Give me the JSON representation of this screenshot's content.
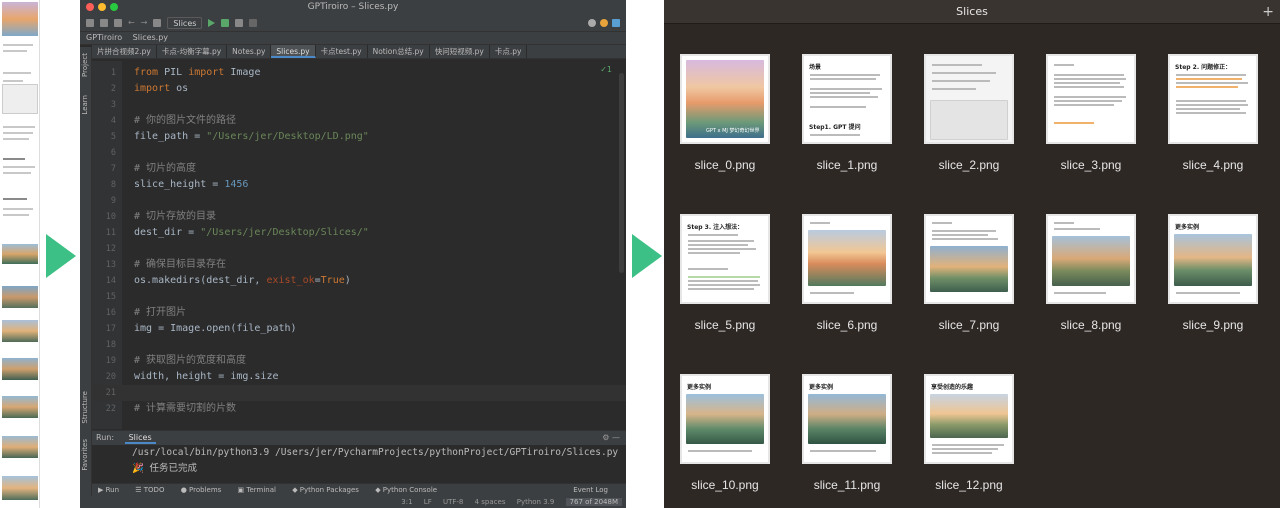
{
  "ide": {
    "window_title": "GPTiroiro – Slices.py",
    "run_config": "Slices",
    "breadcrumbs": [
      "GPTiroiro",
      "Slices.py"
    ],
    "tabs": [
      "片拼合视频2.py",
      "卡点-均衡字幕.py",
      "Notes.py",
      "Slices.py",
      "卡点test.py",
      "Notion总结.py",
      "快问短视频.py",
      "卡点.py"
    ],
    "active_tab": "Slices.py",
    "side_labels": [
      "Project",
      "Learn",
      "Structure",
      "Favorites"
    ],
    "inspection": "✓1",
    "code": [
      {
        "n": "1",
        "parts": [
          {
            "t": "from ",
            "c": "kw"
          },
          {
            "t": "PIL ",
            "c": "id"
          },
          {
            "t": "import ",
            "c": "kw"
          },
          {
            "t": "Image",
            "c": "id"
          }
        ]
      },
      {
        "n": "2",
        "parts": [
          {
            "t": "import ",
            "c": "kw"
          },
          {
            "t": "os",
            "c": "id"
          }
        ]
      },
      {
        "n": "3",
        "parts": []
      },
      {
        "n": "4",
        "parts": [
          {
            "t": "# 你的图片文件的路径",
            "c": "cm"
          }
        ]
      },
      {
        "n": "5",
        "parts": [
          {
            "t": "file_path = ",
            "c": "id"
          },
          {
            "t": "\"/Users/jer/Desktop/LD.png\"",
            "c": "st"
          }
        ]
      },
      {
        "n": "6",
        "parts": []
      },
      {
        "n": "7",
        "parts": [
          {
            "t": "# 切片的高度",
            "c": "cm"
          }
        ]
      },
      {
        "n": "8",
        "parts": [
          {
            "t": "slice_height = ",
            "c": "id"
          },
          {
            "t": "1456",
            "c": "nu"
          }
        ]
      },
      {
        "n": "9",
        "parts": []
      },
      {
        "n": "10",
        "parts": [
          {
            "t": "# 切片存放的目录",
            "c": "cm"
          }
        ]
      },
      {
        "n": "11",
        "parts": [
          {
            "t": "dest_dir = ",
            "c": "id"
          },
          {
            "t": "\"/Users/jer/Desktop/Slices/\"",
            "c": "st"
          }
        ]
      },
      {
        "n": "12",
        "parts": []
      },
      {
        "n": "13",
        "parts": [
          {
            "t": "# 确保目标目录存在",
            "c": "cm"
          }
        ]
      },
      {
        "n": "14",
        "parts": [
          {
            "t": "os.makedirs(dest_dir, ",
            "c": "id"
          },
          {
            "t": "exist_ok",
            "c": "pm"
          },
          {
            "t": "=",
            "c": "id"
          },
          {
            "t": "True",
            "c": "kw"
          },
          {
            "t": ")",
            "c": "id"
          }
        ]
      },
      {
        "n": "15",
        "parts": []
      },
      {
        "n": "16",
        "parts": [
          {
            "t": "# 打开图片",
            "c": "cm"
          }
        ]
      },
      {
        "n": "17",
        "parts": [
          {
            "t": "img = Image.open(file_path)",
            "c": "id"
          }
        ]
      },
      {
        "n": "18",
        "parts": []
      },
      {
        "n": "19",
        "parts": [
          {
            "t": "# 获取图片的宽度和高度",
            "c": "cm"
          }
        ]
      },
      {
        "n": "20",
        "parts": [
          {
            "t": "width, height = img.size",
            "c": "id"
          }
        ]
      },
      {
        "n": "21",
        "parts": []
      },
      {
        "n": "22",
        "parts": [
          {
            "t": "# 计算需要切割的片数",
            "c": "cm"
          }
        ]
      }
    ],
    "current_line": "21",
    "run_label": "Run:",
    "run_tab": "Slices",
    "run_output": [
      "/usr/local/bin/python3.9 /Users/jer/PycharmProjects/pythonProject/GPTiroiro/Slices.py",
      "🎉 任务已完成"
    ],
    "bottom_tabs": [
      "▶ Run",
      "☰ TODO",
      "● Problems",
      "▣ Terminal",
      "◆ Python Packages",
      "◆ Python Console"
    ],
    "event_log": "Event Log",
    "status": [
      "3:1",
      "LF",
      "UTF-8",
      "4 spaces",
      "Python 3.9"
    ],
    "memory": "767 of 2048M"
  },
  "finder": {
    "title": "Slices",
    "files": [
      "slice_0.png",
      "slice_1.png",
      "slice_2.png",
      "slice_3.png",
      "slice_4.png",
      "slice_5.png",
      "slice_6.png",
      "slice_7.png",
      "slice_8.png",
      "slice_9.png",
      "slice_10.png",
      "slice_11.png",
      "slice_12.png"
    ],
    "thumb_text": {
      "slice_0": "GPT x MJ 梦幻奇幻世界",
      "slice_1_h": "场景",
      "slice_1_step": "Step1. GPT 提问",
      "slice_4_step": "Step 2. 问题修正：",
      "slice_5_step": "Step 3. 注入想法：",
      "slice_9_h": "更多实例",
      "slice_10_h": "更多实例",
      "slice_11_h": "更多实例",
      "slice_12_h": "享受创造的乐趣"
    }
  }
}
